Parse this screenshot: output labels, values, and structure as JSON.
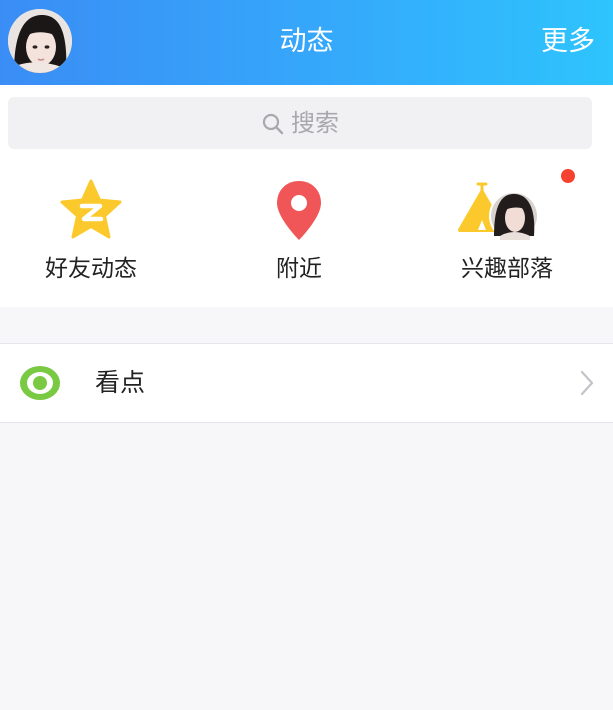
{
  "header": {
    "title": "动态",
    "more_label": "更多",
    "gradient_colors": [
      "#3a8df5",
      "#2ec4fd"
    ]
  },
  "search": {
    "placeholder": "搜索",
    "icon": "search-icon"
  },
  "shortcuts": [
    {
      "label": "好友动态",
      "icon": "qzone-star-icon",
      "color": "#fcc92c"
    },
    {
      "label": "附近",
      "icon": "location-pin-icon",
      "color": "#f05658"
    },
    {
      "label": "兴趣部落",
      "icon": "tribe-tent-icon",
      "color": "#fcc92c",
      "has_notification_dot": true
    }
  ],
  "list": [
    {
      "label": "看点",
      "icon": "eye-icon",
      "color": "#7ac943"
    }
  ],
  "colors": {
    "notification_dot": "#f5412d",
    "page_background": "#f7f7f9"
  }
}
